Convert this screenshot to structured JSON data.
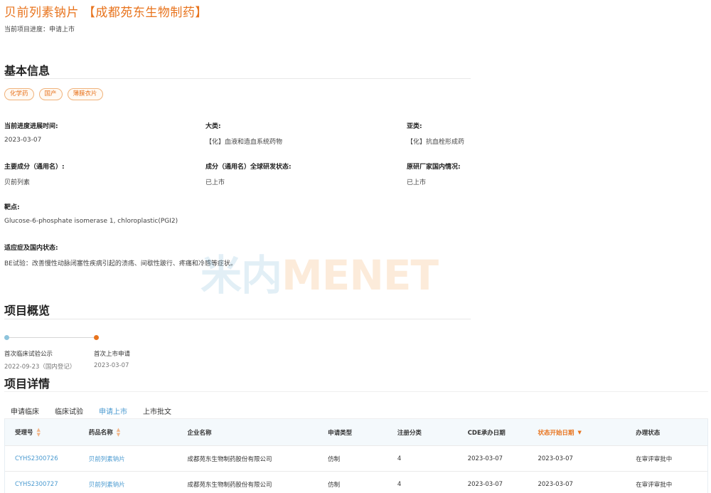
{
  "header": {
    "title": "贝前列素钠片 【成都苑东生物制药】",
    "progress_label": "当前项目进度：",
    "progress_value": "申请上市"
  },
  "basic_info": {
    "section_title": "基本信息",
    "tags": [
      "化学药",
      "国产",
      "薄膜衣片"
    ],
    "fields": [
      {
        "label": "当前进度进展时间:",
        "value": "2023-03-07"
      },
      {
        "label": "大类:",
        "value": "【化】血液和造血系统药物"
      },
      {
        "label": "亚类:",
        "value": "【化】抗血栓形成药"
      },
      {
        "label": "主要成分（通用名）:",
        "value": "贝前列素"
      },
      {
        "label": "成分（通用名）全球研发状态:",
        "value": "已上市"
      },
      {
        "label": "原研厂家国内情况:",
        "value": "已上市"
      },
      {
        "label": "靶点:",
        "value": "Glucose-6-phosphate isomerase 1, chloroplastic(PGI2)"
      },
      {
        "label": "适应症及国内状态:",
        "value": "BE试验：改善慢性动脉闭塞性疾病引起的溃疡、间歇性跛行、疼痛和冷感等症状。"
      }
    ]
  },
  "watermark": {
    "part1": "米内",
    "part2": "MENET"
  },
  "overview": {
    "section_title": "项目概览",
    "milestones": [
      {
        "label": "首次临床试验公示",
        "date": "2022-09-23（国内登记）"
      },
      {
        "label": "首次上市申请",
        "date": "2023-03-07"
      }
    ],
    "colors": {
      "done": "#8ec4dc",
      "current": "#e8741e"
    }
  },
  "details": {
    "section_title": "项目详情",
    "tabs": [
      "申请临床",
      "临床试验",
      "申请上市",
      "上市批文"
    ],
    "active_tab": "申请上市",
    "columns": [
      "受理号",
      "药品名称",
      "企业名称",
      "申请类型",
      "注册分类",
      "CDE承办日期",
      "状态开始日期",
      "办理状态"
    ],
    "rows": [
      [
        "CYHS2300726",
        "贝前列素钠片",
        "成都苑东生物制药股份有限公司",
        "仿制",
        "4",
        "2023-03-07",
        "2023-03-07",
        "在审评审批中"
      ],
      [
        "CYHS2300727",
        "贝前列素钠片",
        "成都苑东生物制药股份有限公司",
        "仿制",
        "4",
        "2023-03-07",
        "2023-03-07",
        "在审评审批中"
      ]
    ]
  },
  "colors": {
    "accent": "#e8741e",
    "link": "#4a9ad0"
  }
}
